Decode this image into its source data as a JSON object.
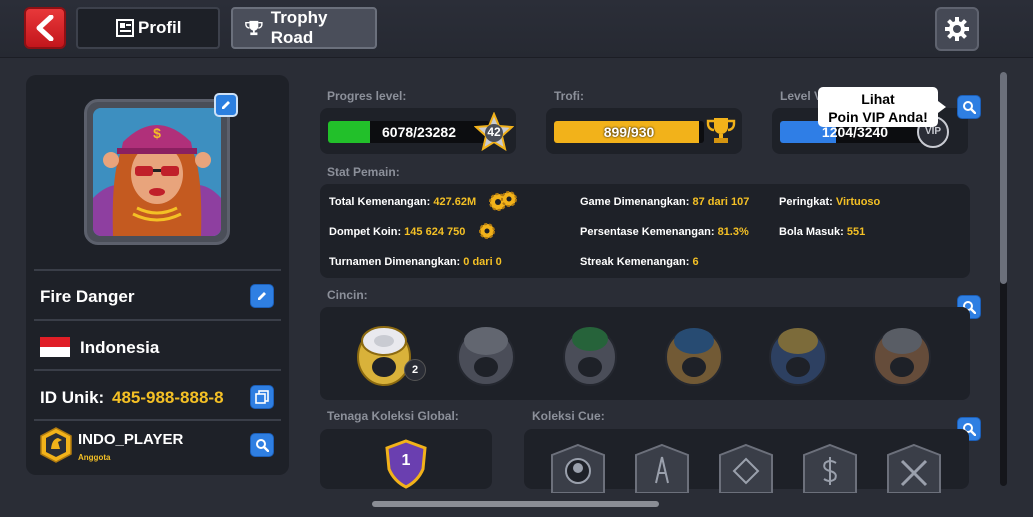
{
  "header": {
    "tab_profil": "Profil",
    "tab_trophy_road": "Trophy Road"
  },
  "profile": {
    "name": "Fire Danger",
    "country": "Indonesia",
    "unique_id_label": "ID Unik:",
    "unique_id_value": "485-988-888-8",
    "club_name": "INDO_PLAYER",
    "club_role": "Anggota"
  },
  "progress": {
    "level_label": "Progres level:",
    "level_text": "6078/23282",
    "level_fraction": 0.261,
    "level_badge": "42",
    "trophy_label": "Trofi:",
    "trophy_text": "899/930",
    "trophy_fraction": 0.967,
    "vip_label": "Level V",
    "vip_text": "1204/3240",
    "vip_fraction": 0.372,
    "vip_badge": "VIP",
    "tooltip_line1": "Lihat",
    "tooltip_line2": "Poin VIP Anda!"
  },
  "stats": {
    "title": "Stat Pemain:",
    "total_wins_label": "Total Kemenangan:",
    "total_wins_value": "427.62M",
    "wallet_label": "Dompet Koin:",
    "wallet_value": "145 624 750",
    "tournaments_label": "Turnamen Dimenangkan:",
    "tournaments_value": "0 dari 0",
    "games_won_label": "Game Dimenangkan:",
    "games_won_value": "87 dari 107",
    "win_pct_label": "Persentase Kemenangan:",
    "win_pct_value": "81.3%",
    "streak_label": "Streak Kemenangan:",
    "streak_value": "6",
    "rank_label": "Peringkat:",
    "rank_value": "Virtuoso",
    "balls_label": "Bola Masuk:",
    "balls_value": "551"
  },
  "rings": {
    "title": "Cincin:",
    "first_ring_count": "2"
  },
  "collections": {
    "global_title": "Tenaga Koleksi Global:",
    "global_level": "1",
    "cue_title": "Koleksi Cue:"
  },
  "colors": {
    "level_fill": "#22c02a",
    "trophy_fill": "#f2b21a",
    "vip_fill": "#2f7ee6",
    "accent_yellow": "#f4c025"
  }
}
